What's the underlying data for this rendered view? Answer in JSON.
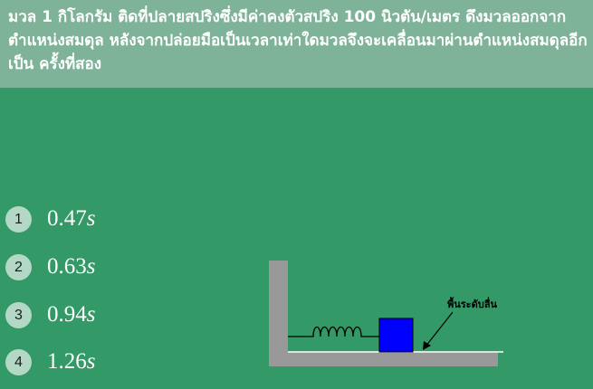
{
  "question": {
    "text": "มวล 1 กิโลกรัม ติดที่ปลายสปริงซึ่งมีค่าคงตัวสปริง 100 นิวตัน/เมตร ดึงมวลออกจากตำแหน่งสมดุล หลังจากปล่อยมือเป็นเวลาเท่าใดมวลจึงจะเคลื่อนมาผ่านตำแหน่งสมดุลอีกเป็น ครั้งที่สอง"
  },
  "choices": [
    {
      "number": "1",
      "value": "0.47",
      "unit": "s"
    },
    {
      "number": "2",
      "value": "0.63",
      "unit": "s"
    },
    {
      "number": "3",
      "value": "0.94",
      "unit": "s"
    },
    {
      "number": "4",
      "value": "1.26",
      "unit": "s"
    }
  ],
  "diagram": {
    "surface_label": "พื้นระดับลื่น"
  },
  "colors": {
    "background": "#339966",
    "question_bar": "#7fb399",
    "badge": "#b3d9c6",
    "block": "#0000ff",
    "wall": "#999999"
  }
}
